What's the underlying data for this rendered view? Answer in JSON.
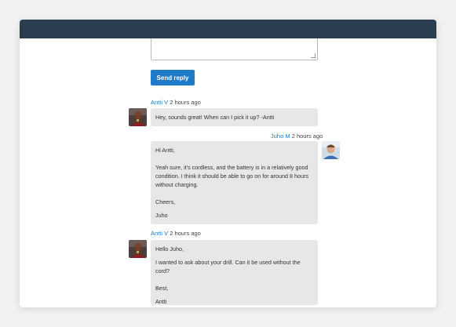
{
  "reply": {
    "send_label": "Send reply"
  },
  "messages": [
    {
      "author": "Antti V",
      "time": "2 hours ago",
      "paragraphs": [
        "Hey, sounds great! When can I pick it up? -Antti"
      ]
    },
    {
      "author": "Juho M",
      "time": "2 hours ago",
      "paragraphs": [
        "Hi Antti,",
        "Yeah sure, it's cordless, and the battery is in a relatively good condition. I think it should be able to go on for around 8 hours without charging.",
        "Cheers,",
        "Juho"
      ]
    },
    {
      "author": "Antti V",
      "time": "2 hours ago",
      "paragraphs": [
        "Hello Juho,",
        "I wanted to ask about your drill. Can it be used without the cord?",
        "Best,",
        "Antti"
      ]
    }
  ],
  "colors": {
    "titlebar": "#2b3e50",
    "accent": "#1f7bc8",
    "bubble": "#e7e7e7"
  }
}
